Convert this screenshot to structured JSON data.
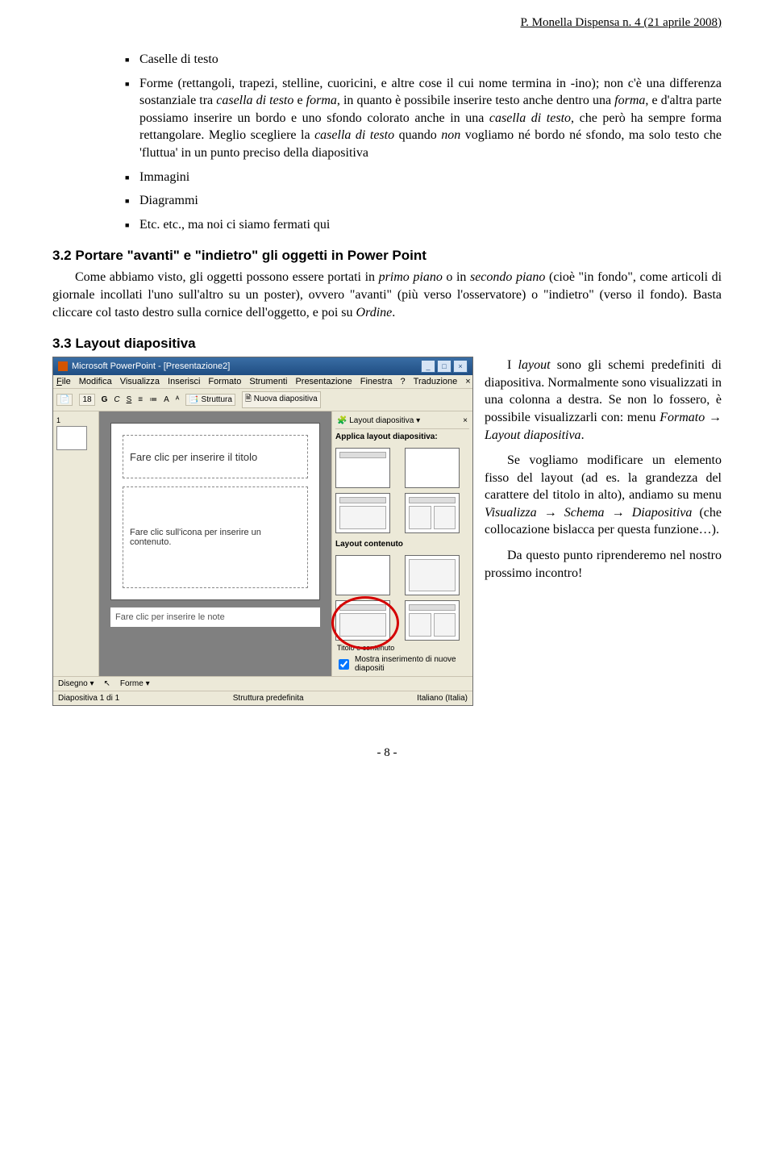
{
  "header": "P. Monella Dispensa n. 4 (21 aprile 2008)",
  "bullets": {
    "b1_plain": "Caselle di testo",
    "b2_html": "Forme (rettangoli, trapezi, stelline, cuoricini, e altre cose il cui nome termina in -ino); non c'è una differenza sostanziale tra <i>casella di testo</i> e <i>forma</i>, in quanto è possibile inserire testo anche dentro una <i>forma</i>, e d'altra parte possiamo inserire un bordo e uno sfondo colorato anche in una <i>casella di testo</i>, che però ha sempre forma rettangolare. Meglio scegliere la <i>casella di testo</i> quando <i>non</i> vogliamo né bordo né sfondo, ma solo testo che 'fluttua' in un punto preciso della diapositiva",
    "b3": "Immagini",
    "b4": "Diagrammi",
    "b5": "Etc. etc., ma noi ci siamo fermati qui"
  },
  "sec32": {
    "title": "3.2 Portare \"avanti\" e \"indietro\" gli oggetti in Power Point",
    "body_html": "Come abbiamo visto, gli oggetti possono essere portati in <i>primo piano</i> o in <i>secondo piano</i> (cioè \"in fondo\", come articoli di giornale incollati l'uno sull'altro su un poster), ovvero \"avanti\" (più verso l'osservatore) o \"indietro\" (verso il fondo). Basta cliccare col tasto destro sulla cornice dell'oggetto, e poi su <i>Ordine</i>."
  },
  "sec33": {
    "title": "3.3 Layout diapositiva",
    "p1_html": "I <i>layout</i> sono gli schemi predefiniti di diapositiva. Normalmente sono visualizzati in una colonna a destra. Se non lo fossero, è possibile visualizzarli con: menu <i>Formato → Layout diapositiva</i>.",
    "p2_html": "Se vogliamo modificare un elemento fisso del layout (ad es. la grandezza del carattere del titolo in alto), andiamo su menu <i>Visualizza → Schema → Diapositiva</i> (che collocazione bislacca per questa funzione…).",
    "p3_html": "Da questo punto riprenderemo nel nostro prossimo incontro!"
  },
  "pp": {
    "title": "Microsoft PowerPoint - [Presentazione2]",
    "menus": [
      "File",
      "Modifica",
      "Visualizza",
      "Inserisci",
      "Formato",
      "Strumenti",
      "Presentazione",
      "Finestra",
      "?",
      "Traduzione"
    ],
    "toolbar": {
      "fontsize": "18",
      "struttura": "Struttura",
      "nuova_dp": "Nuova diapositiva"
    },
    "task": {
      "title": "Layout diapositiva",
      "apply": "Applica layout diapositiva:",
      "section2": "Layout contenuto",
      "circled_caption": "Titolo e contenuto",
      "checkbox": "Mostra inserimento di nuove diapositi"
    },
    "slide": {
      "thumb_num": "1",
      "title_ph": "Fare clic per inserire il titolo",
      "content_ph": "Fare clic sull'icona per inserire un contenuto.",
      "notes_ph": "Fare clic per inserire le note"
    },
    "drawbar": {
      "disegno": "Disegno",
      "forme": "Forme"
    },
    "status": {
      "slide": "Diapositiva 1 di 1",
      "scheme": "Struttura predefinita",
      "lang": "Italiano (Italia)"
    }
  },
  "pagenum": "- 8 -"
}
